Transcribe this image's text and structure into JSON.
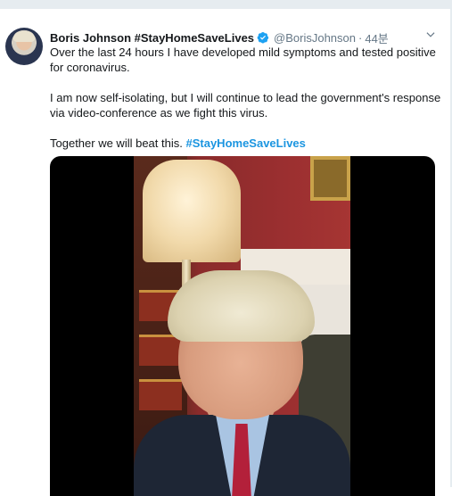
{
  "tweet": {
    "author_name": "Boris Johnson #StayHomeSaveLives",
    "handle": "@BorisJohnson",
    "separator": "·",
    "time": "44분",
    "paragraphs": [
      "Over the last 24 hours I have developed mild symptoms and tested positive for coronavirus.",
      "I am now self-isolating, but I will continue to lead the government's response via video-conference as we fight this virus."
    ],
    "closing_text": "Together we will beat this.",
    "hashtag": "#StayHomeSaveLives"
  },
  "icons": {
    "verified": "verified-badge-icon",
    "menu": "chevron-down-icon"
  },
  "colors": {
    "link": "#1b95e0",
    "verified": "#1da1f2",
    "muted": "#657786",
    "divider": "#e6ecf0"
  }
}
